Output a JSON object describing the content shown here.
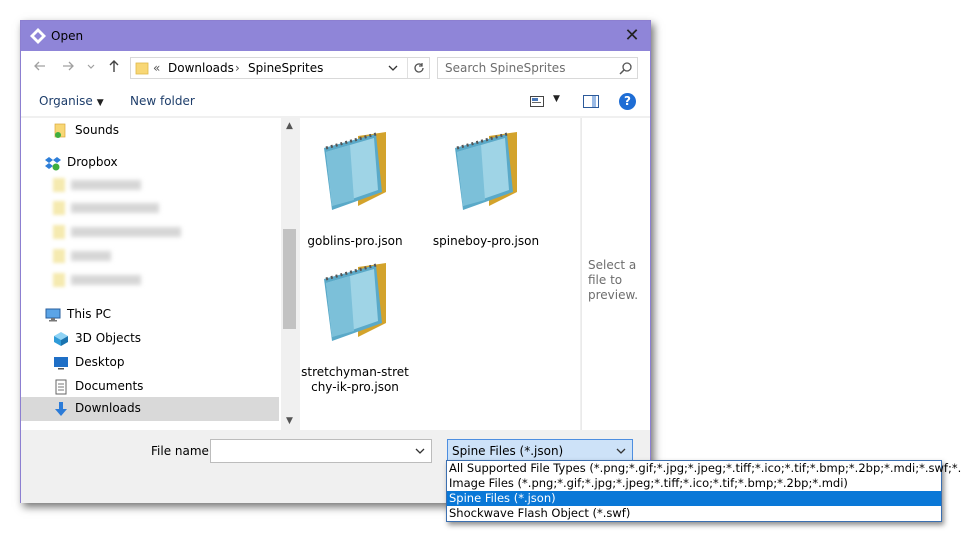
{
  "window": {
    "title": "Open",
    "close_glyph": "✕"
  },
  "nav": {
    "back_icon": "arrow-left-icon",
    "forward_icon": "arrow-right-icon",
    "recent_icon": "chevron-down-icon",
    "up_icon": "arrow-up-icon",
    "breadcrumb_overflow": "«",
    "breadcrumb": [
      "Downloads",
      "SpineSprites"
    ],
    "breadcrumb_sep": "›",
    "search_placeholder": "Search SpineSprites"
  },
  "toolbar": {
    "organise": "Organise",
    "new_folder": "New folder",
    "help": "?"
  },
  "sidebar": {
    "items": [
      {
        "label": "Sounds",
        "icon": "music-folder-icon"
      },
      {
        "label": "Dropbox",
        "icon": "dropbox-icon"
      },
      {
        "label": "This PC",
        "icon": "pc-icon"
      },
      {
        "label": "3D Objects",
        "icon": "3d-objects-icon"
      },
      {
        "label": "Desktop",
        "icon": "desktop-icon"
      },
      {
        "label": "Documents",
        "icon": "documents-icon"
      },
      {
        "label": "Downloads",
        "icon": "downloads-icon"
      }
    ]
  },
  "files": [
    {
      "name": "goblins-pro.json",
      "icon": "notepad-icon"
    },
    {
      "name": "spineboy-pro.json",
      "icon": "notepad-icon"
    },
    {
      "name": "stretchyman-stretchy-ik-pro.json",
      "icon": "notepad-icon"
    }
  ],
  "preview": {
    "message": "Select a file to preview."
  },
  "bottom": {
    "file_name_label": "File name:",
    "file_name_value": "",
    "file_type_value": "Spine Files (*.json)"
  },
  "file_types": [
    "All Supported File Types (*.png;*.gif;*.jpg;*.jpeg;*.tiff;*.ico;*.tif;*.bmp;*.2bp;*.mdi;*.swf;*.json)",
    "Image Files (*.png;*.gif;*.jpg;*.jpeg;*.tiff;*.ico;*.tif;*.bmp;*.2bp;*.mdi)",
    "Spine Files (*.json)",
    "Shockwave Flash Object (*.swf)"
  ],
  "selected_file_type_index": 2,
  "colors": {
    "titlebar": "#8f85d8",
    "selection": "#0a78d7",
    "accent": "#1e6dd5"
  }
}
